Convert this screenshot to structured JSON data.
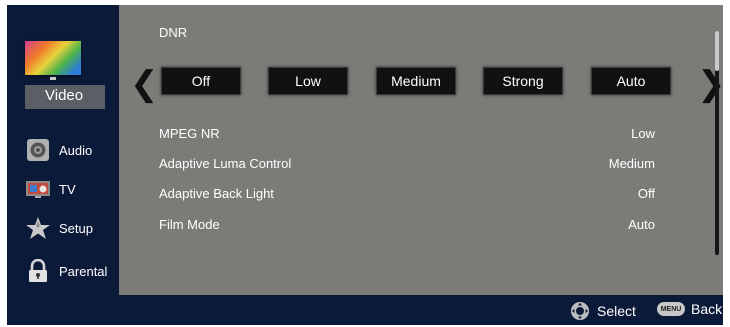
{
  "sidebar": {
    "items": [
      {
        "label": "Video",
        "icon": "tv-color-icon",
        "selected": true
      },
      {
        "label": "Audio",
        "icon": "speaker-icon"
      },
      {
        "label": "TV",
        "icon": "tv-icon"
      },
      {
        "label": "Setup",
        "icon": "star-icon"
      },
      {
        "label": "Parental",
        "icon": "lock-icon"
      }
    ]
  },
  "main": {
    "title": "DNR",
    "options": [
      "Off",
      "Low",
      "Medium",
      "Strong",
      "Auto"
    ],
    "rows": [
      {
        "label": "MPEG NR",
        "value": "Low"
      },
      {
        "label": "Adaptive Luma Control",
        "value": "Medium"
      },
      {
        "label": "Adaptive Back Light",
        "value": "Off"
      },
      {
        "label": "Film Mode",
        "value": "Auto"
      }
    ]
  },
  "footer": {
    "select_label": "Select",
    "menu_key": "MENU",
    "back_label": "Back"
  },
  "colors": {
    "sidebar_bg": "#0c1a3a",
    "panel_bg": "#7c7b78",
    "button_bg": "#111111",
    "text": "#ffffff"
  }
}
